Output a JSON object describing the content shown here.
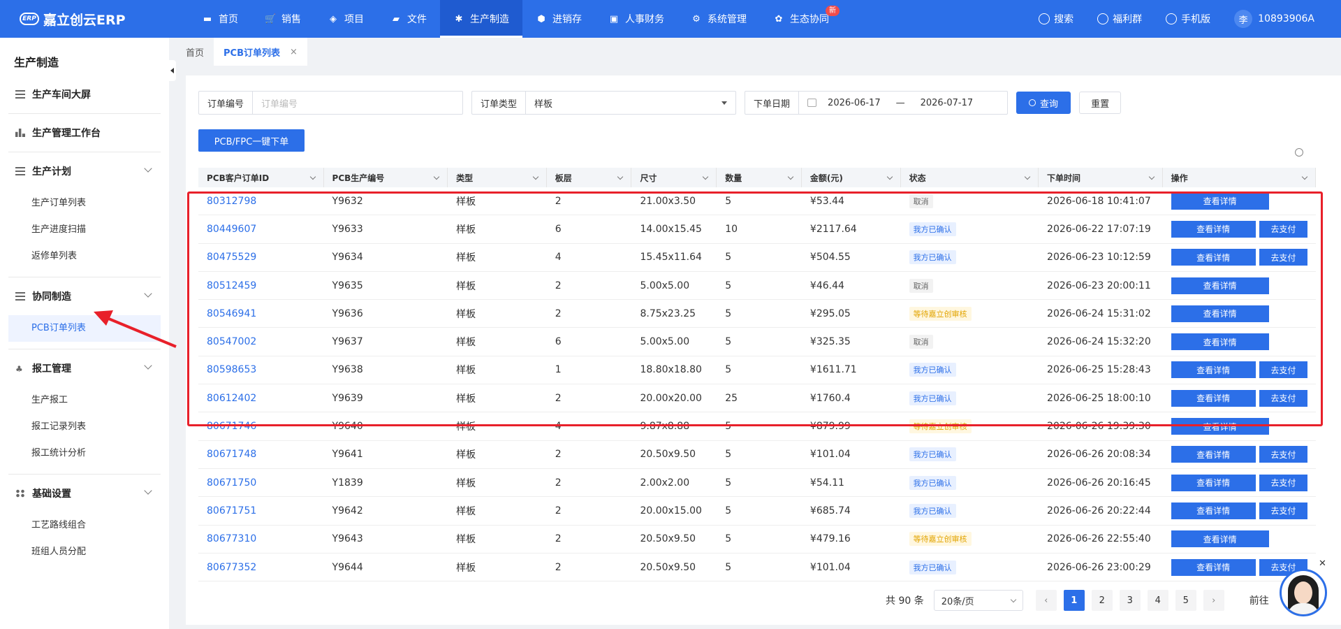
{
  "app": {
    "logo_badge": "ERP",
    "name": "嘉立创云ERP"
  },
  "nav": [
    {
      "label": "首页",
      "icon": "monitor-icon"
    },
    {
      "label": "销售",
      "icon": "cart-icon"
    },
    {
      "label": "项目",
      "icon": "layers-icon"
    },
    {
      "label": "文件",
      "icon": "folder-icon"
    },
    {
      "label": "生产制造",
      "icon": "chip-icon",
      "active": true
    },
    {
      "label": "进销存",
      "icon": "box-icon"
    },
    {
      "label": "人事财务",
      "icon": "finance-icon"
    },
    {
      "label": "系统管理",
      "icon": "gear-icon"
    },
    {
      "label": "生态协同",
      "icon": "ecosystem-icon",
      "badge": "新"
    }
  ],
  "top_right": {
    "search": "搜索",
    "welfare": "福利群",
    "mobile": "手机版",
    "user_initial": "李",
    "user_id": "10893906A"
  },
  "sidebar": {
    "title": "生产制造",
    "groups": [
      {
        "label": "生产车间大屏",
        "icon": "list-icon",
        "items": []
      },
      {
        "label": "生产管理工作台",
        "icon": "chart-icon",
        "items": []
      },
      {
        "label": "生产计划",
        "icon": "list-icon",
        "items": [
          "生产订单列表",
          "生产进度扫描",
          "返修单列表"
        ]
      },
      {
        "label": "协同制造",
        "icon": "list-icon",
        "items": [
          "PCB订单列表"
        ]
      },
      {
        "label": "报工管理",
        "icon": "tree-icon",
        "items": [
          "生产报工",
          "报工记录列表",
          "报工统计分析"
        ]
      },
      {
        "label": "基础设置",
        "icon": "grid-icon",
        "items": [
          "工艺路线组合",
          "班组人员分配"
        ]
      }
    ]
  },
  "tabs": [
    {
      "label": "首页"
    },
    {
      "label": "PCB订单列表",
      "active": true,
      "close": "×"
    }
  ],
  "filters": {
    "order_no_label": "订单编号",
    "order_no_placeholder": "订单编号",
    "order_type_label": "订单类型",
    "order_type_value": "样板",
    "date_label": "下单日期",
    "date_start": "2026-06-17",
    "date_sep": "—",
    "date_end": "2026-07-17",
    "query_label": "查询",
    "reset_label": "重置"
  },
  "order_button": "PCB/FPC一键下单",
  "table": {
    "columns": [
      "PCB客户订单ID",
      "PCB生产编号",
      "类型",
      "板层",
      "尺寸",
      "数量",
      "金额(元)",
      "状态",
      "下单时间",
      "操作"
    ],
    "detail_label": "查看详情",
    "pay_label": "去支付",
    "rows": [
      {
        "id": "80312798",
        "prod": "Y9632",
        "type": "样板",
        "layer": "2",
        "size": "21.00x3.50",
        "qty": "5",
        "amount": "¥53.44",
        "status": "取消",
        "status_kind": "cancel",
        "time": "2026-06-18 10:41:07",
        "pay": false
      },
      {
        "id": "80449607",
        "prod": "Y9633",
        "type": "样板",
        "layer": "6",
        "size": "14.00x15.45",
        "qty": "10",
        "amount": "¥2117.64",
        "status": "我方已确认",
        "status_kind": "ok",
        "time": "2026-06-22 17:07:19",
        "pay": true
      },
      {
        "id": "80475529",
        "prod": "Y9634",
        "type": "样板",
        "layer": "4",
        "size": "15.45x11.64",
        "qty": "5",
        "amount": "¥504.55",
        "status": "我方已确认",
        "status_kind": "ok",
        "time": "2026-06-23 10:12:59",
        "pay": true
      },
      {
        "id": "80512459",
        "prod": "Y9635",
        "type": "样板",
        "layer": "2",
        "size": "5.00x5.00",
        "qty": "5",
        "amount": "¥46.44",
        "status": "取消",
        "status_kind": "cancel",
        "time": "2026-06-23 20:00:11",
        "pay": false
      },
      {
        "id": "80546941",
        "prod": "Y9636",
        "type": "样板",
        "layer": "2",
        "size": "8.75x23.25",
        "qty": "5",
        "amount": "¥295.05",
        "status": "等待嘉立创审核",
        "status_kind": "wait",
        "time": "2026-06-24 15:31:02",
        "pay": false
      },
      {
        "id": "80547002",
        "prod": "Y9637",
        "type": "样板",
        "layer": "6",
        "size": "5.00x5.00",
        "qty": "5",
        "amount": "¥325.35",
        "status": "取消",
        "status_kind": "cancel",
        "time": "2026-06-24 15:32:20",
        "pay": false
      },
      {
        "id": "80598653",
        "prod": "Y9638",
        "type": "样板",
        "layer": "1",
        "size": "18.80x18.80",
        "qty": "5",
        "amount": "¥1611.71",
        "status": "我方已确认",
        "status_kind": "ok",
        "time": "2026-06-25 15:28:43",
        "pay": true
      },
      {
        "id": "80612402",
        "prod": "Y9639",
        "type": "样板",
        "layer": "2",
        "size": "20.00x20.00",
        "qty": "25",
        "amount": "¥1760.4",
        "status": "我方已确认",
        "status_kind": "ok",
        "time": "2026-06-25 18:00:10",
        "pay": true
      },
      {
        "id": "80671746",
        "prod": "Y9640",
        "type": "样板",
        "layer": "4",
        "size": "9.87x8.88",
        "qty": "5",
        "amount": "¥879.99",
        "status": "等待嘉立创审核",
        "status_kind": "wait",
        "time": "2026-06-26 19:39:30",
        "pay": false
      },
      {
        "id": "80671748",
        "prod": "Y9641",
        "type": "样板",
        "layer": "2",
        "size": "20.50x9.50",
        "qty": "5",
        "amount": "¥101.04",
        "status": "我方已确认",
        "status_kind": "ok",
        "time": "2026-06-26 20:08:34",
        "pay": true
      },
      {
        "id": "80671750",
        "prod": "Y1839",
        "type": "样板",
        "layer": "2",
        "size": "2.00x2.00",
        "qty": "5",
        "amount": "¥54.11",
        "status": "我方已确认",
        "status_kind": "ok",
        "time": "2026-06-26 20:16:45",
        "pay": true
      },
      {
        "id": "80671751",
        "prod": "Y9642",
        "type": "样板",
        "layer": "2",
        "size": "20.00x15.00",
        "qty": "5",
        "amount": "¥685.74",
        "status": "我方已确认",
        "status_kind": "ok",
        "time": "2026-06-26 20:22:44",
        "pay": true
      },
      {
        "id": "80677310",
        "prod": "Y9643",
        "type": "样板",
        "layer": "2",
        "size": "20.50x9.50",
        "qty": "5",
        "amount": "¥479.16",
        "status": "等待嘉立创审核",
        "status_kind": "wait",
        "time": "2026-06-26 22:55:40",
        "pay": false
      },
      {
        "id": "80677352",
        "prod": "Y9644",
        "type": "样板",
        "layer": "2",
        "size": "20.50x9.50",
        "qty": "5",
        "amount": "¥101.04",
        "status": "我方已确认",
        "status_kind": "ok",
        "time": "2026-06-26 23:00:29",
        "pay": true
      }
    ]
  },
  "pagination": {
    "total": "共 90 条",
    "page_size": "20条/页",
    "pages": [
      "1",
      "2",
      "3",
      "4",
      "5"
    ],
    "current": "1",
    "goto": "前往"
  },
  "colors": {
    "primary": "#2c6fe8",
    "highlight": "#e8202a"
  }
}
